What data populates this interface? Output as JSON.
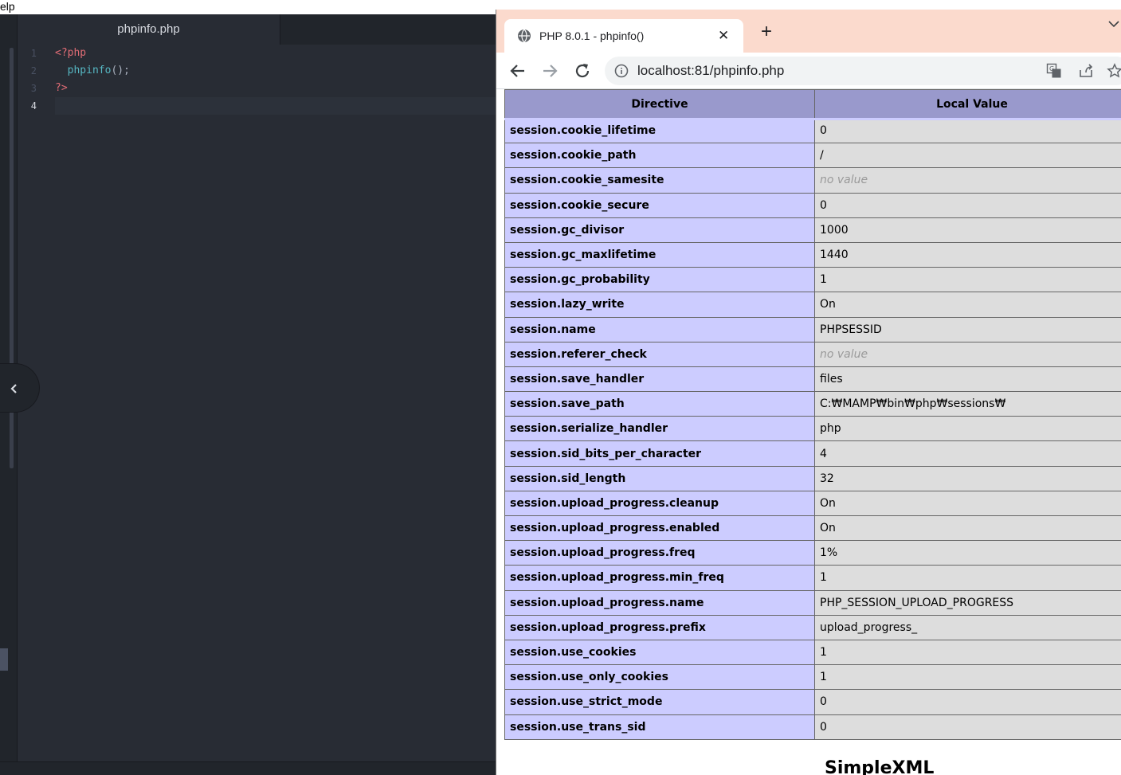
{
  "os_menu": {
    "fragment": "elp"
  },
  "editor": {
    "tab_title": "phpinfo.php",
    "line_numbers": [
      "1",
      "2",
      "3",
      "4"
    ],
    "code": {
      "line1": "<?php",
      "line2_fn": "phpinfo",
      "line2_punc": "();",
      "line3": "?>"
    },
    "sidebar_toggle_icon": "chevron-left-icon"
  },
  "browser": {
    "tab_title": "PHP 8.0.1 - phpinfo()",
    "tab_close": "✕",
    "new_tab": "+",
    "url": "localhost:81/phpinfo.php",
    "tab_strip_color": "#fbdacd"
  },
  "phpinfo": {
    "headers": {
      "directive": "Directive",
      "local_value": "Local Value"
    },
    "rows": [
      {
        "directive": "session.cookie_lifetime",
        "value": "0"
      },
      {
        "directive": "session.cookie_path",
        "value": "/"
      },
      {
        "directive": "session.cookie_samesite",
        "value": "no value"
      },
      {
        "directive": "session.cookie_secure",
        "value": "0"
      },
      {
        "directive": "session.gc_divisor",
        "value": "1000"
      },
      {
        "directive": "session.gc_maxlifetime",
        "value": "1440"
      },
      {
        "directive": "session.gc_probability",
        "value": "1"
      },
      {
        "directive": "session.lazy_write",
        "value": "On"
      },
      {
        "directive": "session.name",
        "value": "PHPSESSID"
      },
      {
        "directive": "session.referer_check",
        "value": "no value"
      },
      {
        "directive": "session.save_handler",
        "value": "files"
      },
      {
        "directive": "session.save_path",
        "value": "C:₩MAMP₩bin₩php₩sessions₩"
      },
      {
        "directive": "session.serialize_handler",
        "value": "php"
      },
      {
        "directive": "session.sid_bits_per_character",
        "value": "4"
      },
      {
        "directive": "session.sid_length",
        "value": "32"
      },
      {
        "directive": "session.upload_progress.cleanup",
        "value": "On"
      },
      {
        "directive": "session.upload_progress.enabled",
        "value": "On"
      },
      {
        "directive": "session.upload_progress.freq",
        "value": "1%"
      },
      {
        "directive": "session.upload_progress.min_freq",
        "value": "1"
      },
      {
        "directive": "session.upload_progress.name",
        "value": "PHP_SESSION_UPLOAD_PROGRESS"
      },
      {
        "directive": "session.upload_progress.prefix",
        "value": "upload_progress_"
      },
      {
        "directive": "session.use_cookies",
        "value": "1"
      },
      {
        "directive": "session.use_only_cookies",
        "value": "1"
      },
      {
        "directive": "session.use_strict_mode",
        "value": "0"
      },
      {
        "directive": "session.use_trans_sid",
        "value": "0"
      }
    ],
    "next_section": "SimpleXML",
    "colors": {
      "header": "#9999cc",
      "directive_cell": "#ccccff",
      "value_cell": "#dddddd"
    }
  }
}
